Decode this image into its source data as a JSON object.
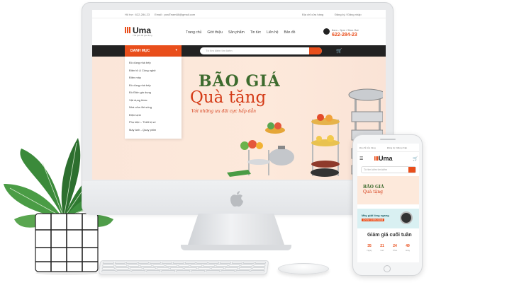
{
  "site": {
    "topbar": {
      "hotline": "Hỏ trợ : 622-284-23",
      "email": "Email : pxalTeam88@gmail.com",
      "store": "Địa chỉ cửa hàng",
      "auth": "Đăng ký / Đăng nhập"
    },
    "logo": {
      "name": "Uma",
      "tagline": "Thế giới đồ gia dụng"
    },
    "nav": [
      "Trang chủ",
      "Giới thiệu",
      "Sản phẩm",
      "Tin tức",
      "Liên hệ",
      "Bản đồ"
    ],
    "hotline_block": {
      "hours": "8am - 9pm / Mon-Sat",
      "number": "622-284-23"
    },
    "category_button": "DANH MỤC",
    "search": {
      "placeholder": "Từ tìm kiếm tìm kiếm"
    },
    "cart_count": "0",
    "categories": [
      "Đồ dùng nhà bếp",
      "Điện tử & Công nghệ",
      "Điện máy",
      "Đồ dùng nhà bếp",
      "Đồ Điện gia dụng",
      "Vật dụng khác",
      "Nhà cửa đời sống",
      "Điện lạnh",
      "Phụ kiện - Thiết bị số",
      "Máy ảnh - Quay phim"
    ],
    "banner": {
      "title_line1": "BÃO GIÁ",
      "title_line2": "Quà tặng",
      "subtitle": "Với những ưu đãi cực hấp dẫn"
    }
  },
  "mobile": {
    "topbar": {
      "store": "Địa chỉ cửa hàng",
      "auth": "Đăng ký / Đăng nhập"
    },
    "logo": "Uma",
    "search_placeholder": "Từ tìm kiếm tìm kiếm",
    "banner": {
      "line1": "BÃO GIÁ",
      "line2": "Quà tặng"
    },
    "promo": {
      "title": "Máy giặt lồng ngang",
      "price": "Chỉ từ 5.990.000đ"
    },
    "deal_title": "Giảm giá cuối tuần",
    "countdown": [
      {
        "value": "35",
        "unit": "Ngày"
      },
      {
        "value": "21",
        "unit": "Giờ"
      },
      {
        "value": "24",
        "unit": "Phút"
      },
      {
        "value": "49",
        "unit": "Giây"
      }
    ]
  },
  "colors": {
    "accent": "#e94e1b",
    "dark_bar": "#222222",
    "banner_green": "#3d6b2e",
    "banner_red": "#d43b17"
  },
  "icons": [
    "apple-logo-icon",
    "phone-icon",
    "cart-icon",
    "search-icon",
    "menu-icon"
  ]
}
